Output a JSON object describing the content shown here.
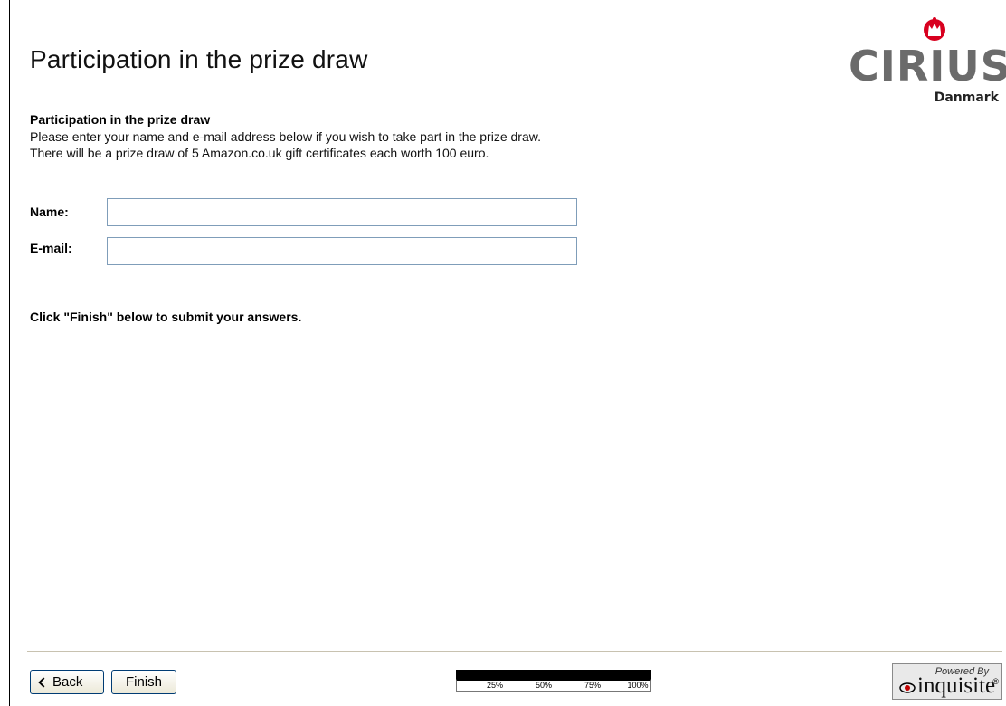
{
  "header": {
    "title": "Participation in the prize draw"
  },
  "logo": {
    "wordmark": "CIRIUS",
    "subtitle": "Danmark",
    "crown_color": "#d8001f"
  },
  "content": {
    "heading": "Participation in the prize draw",
    "intro_line_1": "Please enter your name and e-mail address below if you wish to take part in the prize draw.",
    "intro_line_2": "There will be a prize draw of 5 Amazon.co.uk gift certificates each worth 100 euro."
  },
  "form": {
    "name_label": "Name:",
    "name_value": "",
    "email_label": "E-mail:",
    "email_value": ""
  },
  "instructions": {
    "finish_note": "Click \"Finish\" below to submit your answers."
  },
  "footer": {
    "back_label": "Back",
    "finish_label": "Finish",
    "progress": {
      "percent": 100,
      "ticks": [
        "25%",
        "50%",
        "75%",
        "100%"
      ]
    },
    "powered": {
      "by_text": "Powered By",
      "brand": "inquisite",
      "reg_mark": "®"
    }
  }
}
